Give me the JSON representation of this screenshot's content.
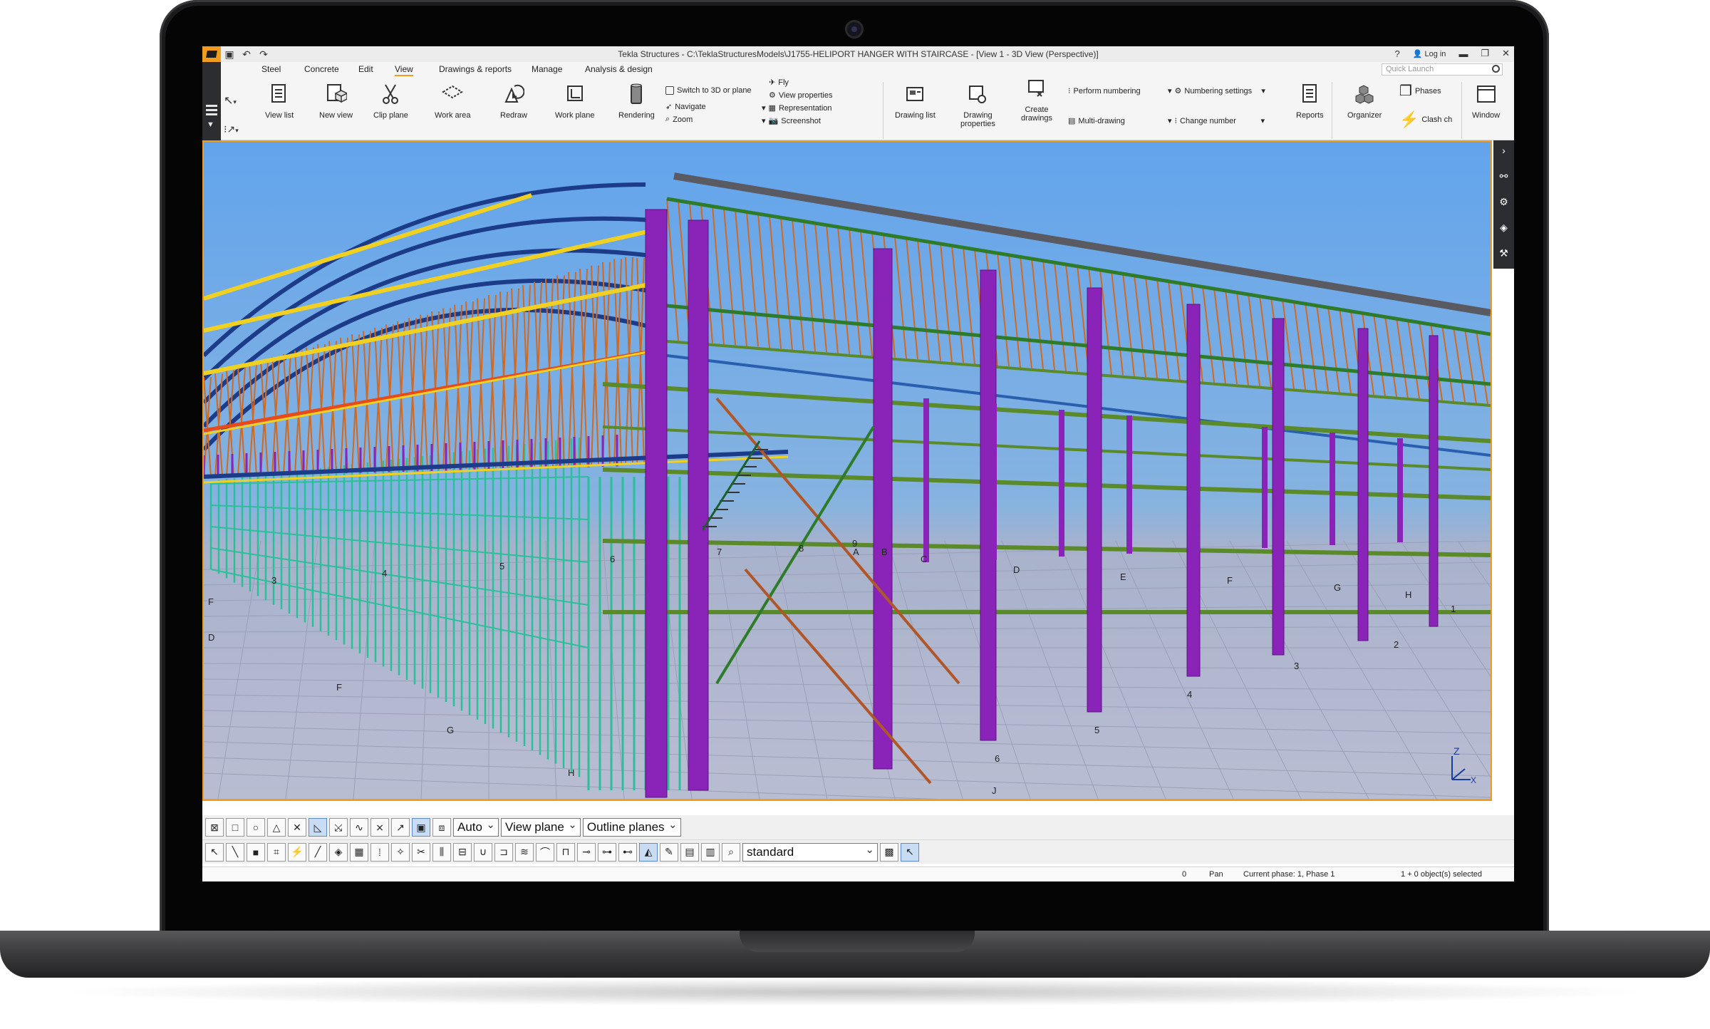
{
  "window": {
    "title": "Tekla Structures - C:\\TeklaStructuresModels\\J1755-HELIPORT HANGER WITH STAIRCASE - [View 1 - 3D View (Perspective)]",
    "login_label": "Log in",
    "help_label": "?"
  },
  "tabs": [
    {
      "label": "Steel"
    },
    {
      "label": "Concrete"
    },
    {
      "label": "Edit"
    },
    {
      "label": "View"
    },
    {
      "label": "Drawings & reports"
    },
    {
      "label": "Manage"
    },
    {
      "label": "Analysis & design"
    }
  ],
  "active_tab": "View",
  "quick_launch": {
    "placeholder": "Quick Launch"
  },
  "ribbon": {
    "view_list": "View list",
    "new_view": "New view",
    "clip_plane": "Clip plane",
    "work_area": "Work area",
    "redraw": "Redraw",
    "work_plane": "Work plane",
    "rendering": "Rendering",
    "switch_3d": "Switch to 3D or plane",
    "navigate": "Navigate",
    "zoom": "Zoom",
    "fly": "Fly",
    "view_properties": "View properties",
    "representation": "Representation",
    "screenshot": "Screenshot",
    "drawing_list": "Drawing list",
    "drawing_properties_1": "Drawing",
    "drawing_properties_2": "properties",
    "create_drawings_1": "Create",
    "create_drawings_2": "drawings",
    "perform_numbering": "Perform numbering",
    "multi_drawing": "Multi-drawing",
    "numbering_settings": "Numbering settings",
    "change_number": "Change number",
    "reports": "Reports",
    "organizer": "Organizer",
    "phases": "Phases",
    "clash_check": "Clash ch",
    "window": "Window"
  },
  "grid_labels": {
    "numbers": [
      "3",
      "4",
      "5",
      "6",
      "7",
      "8",
      "9",
      "1",
      "2",
      "3",
      "4",
      "5",
      "6"
    ],
    "letters": [
      "A",
      "B",
      "C",
      "D",
      "E",
      "F",
      "G",
      "H",
      "J",
      "F",
      "G",
      "H",
      "D",
      "F"
    ]
  },
  "toolbar1": {
    "auto": "Auto",
    "view_plane": "View plane",
    "outline_planes": "Outline planes"
  },
  "toolbar2": {
    "standard": "standard"
  },
  "status": {
    "count": "0",
    "mode": "Pan",
    "phase": "Current phase: 1, Phase 1",
    "selected": "1 + 0 object(s) selected"
  },
  "colors": {
    "accent": "#f29c1f",
    "sky": "#6fa8e6",
    "purple_columns": "#8a24b8",
    "orange_truss": "#d2691e",
    "green_members": "#5a8a2a",
    "teal_wall": "#2bbf9a",
    "yellow_purlin": "#f0d020"
  }
}
